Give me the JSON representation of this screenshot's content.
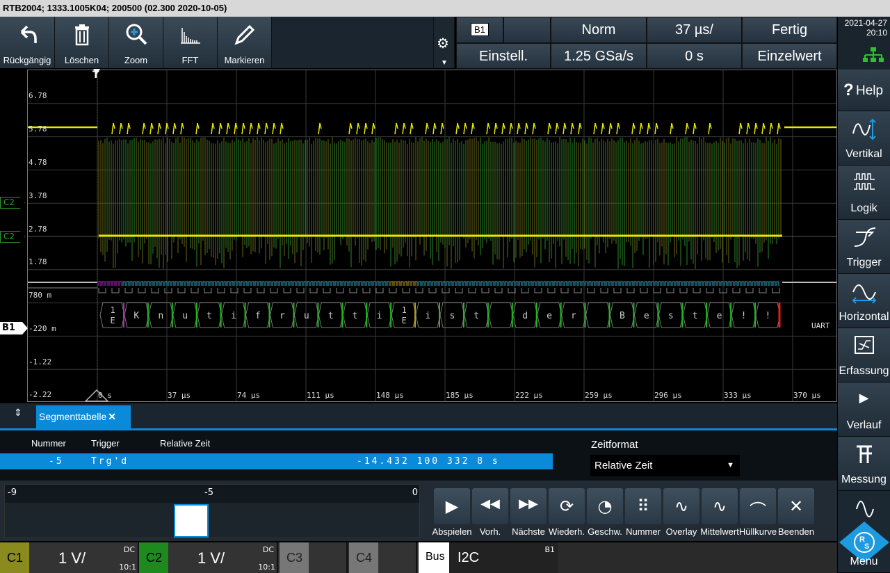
{
  "titlebar": "RTB2004; 1333.1005K04; 200500 (02.300 2020-10-05)",
  "toolbar": [
    {
      "label": "Rückgängig",
      "icon": "undo-icon"
    },
    {
      "label": "Löschen",
      "icon": "trash-icon"
    },
    {
      "label": "Zoom",
      "icon": "zoom-icon"
    },
    {
      "label": "FFT",
      "icon": "fft-icon"
    },
    {
      "label": "Markieren",
      "icon": "pen-icon"
    }
  ],
  "status": {
    "source": "B1",
    "mode": "Norm",
    "timebase": "37 µs/",
    "state": "Fertig",
    "setup": "Einstell.",
    "samplerate": "1.25 GSa/s",
    "offset": "0 s",
    "acq": "Einzelwert"
  },
  "datetime": {
    "date": "2021-04-27",
    "time": "20:10"
  },
  "right_menu": [
    "Help",
    "Vertikal",
    "Logik",
    "Trigger",
    "Horizontal",
    "Erfassung",
    "Verlauf",
    "Messung",
    "Menu"
  ],
  "help_prefix": "?",
  "y_labels": [
    "6.78",
    "5.78",
    "4.78",
    "3.78",
    "2.78",
    "1.78",
    "780 m",
    "-220 m",
    "-1.22",
    "-2.22"
  ],
  "x_labels": [
    "0 s",
    "37 µs",
    "74 µs",
    "111 µs",
    "148 µs",
    "185 µs",
    "222 µs",
    "259 µs",
    "296 µs",
    "333 µs",
    "370 µs"
  ],
  "trigger_marker": "T",
  "ch_markers": {
    "c2_upper": "C2",
    "c2_lower": "C2",
    "b1": "B1"
  },
  "uart_label": "UART",
  "decoded_chars": [
    "1E",
    "K",
    "n",
    "u",
    "t",
    "i",
    "f",
    "r",
    "u",
    "t",
    "t",
    "i",
    "1E",
    "i",
    "s",
    "t",
    "",
    "d",
    "e",
    "r",
    "",
    "B",
    "e",
    "s",
    "t",
    "e",
    "!",
    "!"
  ],
  "segment_tab": "Segmenttabelle",
  "table": {
    "headers": [
      "Nummer",
      "Trigger",
      "Relative Zeit"
    ],
    "row": {
      "num": "-5",
      "trig": "Trg'd",
      "time": "-14.432 100 332 8 s"
    }
  },
  "zeitformat": {
    "label": "Zeitformat",
    "value": "Relative Zeit"
  },
  "slider": {
    "min": "-9",
    "mid": "-5",
    "max": "0"
  },
  "controls": [
    "Abspielen",
    "Vorh.",
    "Nächste",
    "Wiederh.",
    "Geschw.",
    "Nummer",
    "Overlay",
    "Mittelwert",
    "Hüllkurve",
    "Beenden"
  ],
  "channels": [
    {
      "name": "C1",
      "value": "1 V/",
      "coupling": "DC",
      "probe": "10:1",
      "color": "#8a8a1e"
    },
    {
      "name": "C2",
      "value": "1 V/",
      "coupling": "DC",
      "probe": "10:1",
      "color": "#1e8a1e"
    },
    {
      "name": "C3",
      "value": "",
      "color": "#777"
    },
    {
      "name": "C4",
      "value": "",
      "color": "#777"
    }
  ],
  "bus": {
    "label": "Bus",
    "value": "I2C",
    "src": "B1"
  },
  "colors": {
    "yellow": "#e8e800",
    "green": "#1dbb1d",
    "cyan": "#2aa9b8",
    "magenta": "#c020c0",
    "accent": "#0a8ad8"
  }
}
